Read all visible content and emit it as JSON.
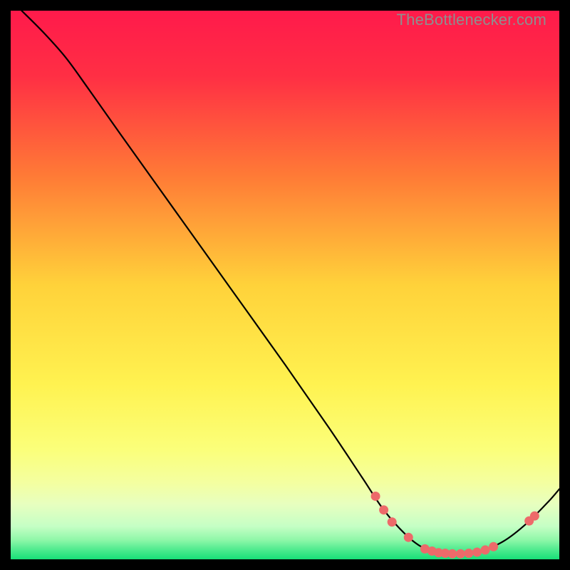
{
  "watermark": "TheBottlenecker.com",
  "chart_data": {
    "type": "line",
    "title": "",
    "xlabel": "",
    "ylabel": "",
    "xlim": [
      0,
      100
    ],
    "ylim": [
      0,
      100
    ],
    "background_gradient_stops": [
      {
        "t": 0.0,
        "color": "#ff1a4b"
      },
      {
        "t": 0.12,
        "color": "#ff2f44"
      },
      {
        "t": 0.3,
        "color": "#ff7a36"
      },
      {
        "t": 0.5,
        "color": "#ffd23a"
      },
      {
        "t": 0.68,
        "color": "#fff250"
      },
      {
        "t": 0.8,
        "color": "#fbff7a"
      },
      {
        "t": 0.86,
        "color": "#f4ffa0"
      },
      {
        "t": 0.9,
        "color": "#e7ffbf"
      },
      {
        "t": 0.94,
        "color": "#c5ffc5"
      },
      {
        "t": 0.965,
        "color": "#8ef7a8"
      },
      {
        "t": 0.985,
        "color": "#46e98b"
      },
      {
        "t": 1.0,
        "color": "#18df78"
      }
    ],
    "curve": [
      {
        "x": 2.0,
        "y": 100.0
      },
      {
        "x": 6.0,
        "y": 96.0
      },
      {
        "x": 10.0,
        "y": 91.5
      },
      {
        "x": 14.0,
        "y": 86.0
      },
      {
        "x": 20.0,
        "y": 77.5
      },
      {
        "x": 30.0,
        "y": 63.5
      },
      {
        "x": 40.0,
        "y": 49.5
      },
      {
        "x": 50.0,
        "y": 35.5
      },
      {
        "x": 58.0,
        "y": 24.0
      },
      {
        "x": 64.0,
        "y": 15.0
      },
      {
        "x": 68.0,
        "y": 9.0
      },
      {
        "x": 72.0,
        "y": 4.5
      },
      {
        "x": 75.0,
        "y": 2.2
      },
      {
        "x": 78.0,
        "y": 1.2
      },
      {
        "x": 82.0,
        "y": 1.0
      },
      {
        "x": 86.0,
        "y": 1.6
      },
      {
        "x": 90.0,
        "y": 3.4
      },
      {
        "x": 94.0,
        "y": 6.5
      },
      {
        "x": 98.0,
        "y": 10.5
      },
      {
        "x": 100.0,
        "y": 12.8
      }
    ],
    "markers": [
      {
        "x": 66.5,
        "y": 11.5
      },
      {
        "x": 68.0,
        "y": 9.0
      },
      {
        "x": 69.5,
        "y": 6.8
      },
      {
        "x": 72.5,
        "y": 4.0
      },
      {
        "x": 75.5,
        "y": 1.9
      },
      {
        "x": 76.8,
        "y": 1.5
      },
      {
        "x": 78.0,
        "y": 1.2
      },
      {
        "x": 79.2,
        "y": 1.1
      },
      {
        "x": 80.5,
        "y": 1.0
      },
      {
        "x": 82.0,
        "y": 1.0
      },
      {
        "x": 83.5,
        "y": 1.1
      },
      {
        "x": 85.0,
        "y": 1.3
      },
      {
        "x": 86.5,
        "y": 1.7
      },
      {
        "x": 88.0,
        "y": 2.3
      },
      {
        "x": 94.5,
        "y": 7.0
      },
      {
        "x": 95.5,
        "y": 7.9
      }
    ],
    "marker_color": "#ed6a6a",
    "curve_color": "#000000"
  }
}
